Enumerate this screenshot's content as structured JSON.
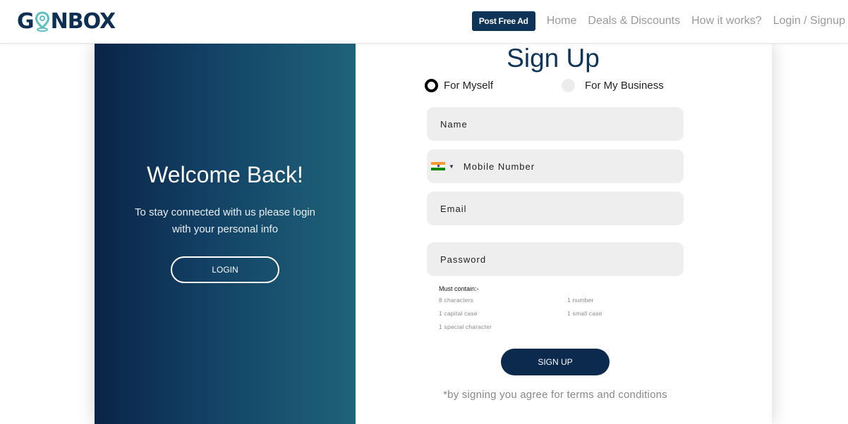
{
  "header": {
    "logo_left": "G",
    "logo_right": "NBOX",
    "post_ad": "Post Free Ad",
    "nav": [
      "Home",
      "Deals & Discounts",
      "How it works?",
      "Login / Signup"
    ]
  },
  "welcome": {
    "title": "Welcome Back!",
    "subtitle": "To stay connected with us please login with your personal info",
    "login_label": "LOGIN"
  },
  "signup": {
    "title": "Sign Up",
    "options": [
      "For Myself",
      "For My Business"
    ],
    "fields": {
      "name": "Name",
      "mobile": "Mobile Number",
      "email": "Email",
      "password": "Password"
    },
    "rules_head": "Must contain:-",
    "rules": [
      "8 characters",
      "1 number",
      "1 capital case",
      "1 small case",
      "1 special character"
    ],
    "submit": "SIGN UP",
    "terms": "*by signing you agree for terms and conditions"
  },
  "colors": {
    "brand": "#0e3557",
    "pin": "#5bc0be"
  },
  "icons": [
    "location-pin-icon",
    "india-flag-icon",
    "caret-down-icon"
  ]
}
